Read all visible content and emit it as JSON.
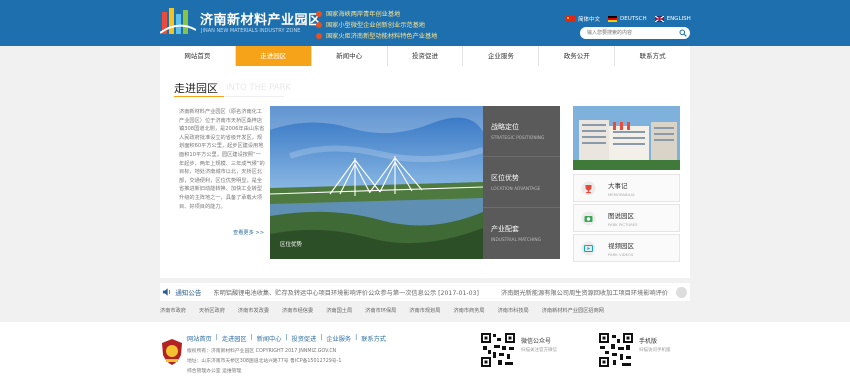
{
  "header": {
    "brand_cn": "济南新材料产业园区",
    "brand_en": "JINAN NEW MATERIALS INDUSTRY ZONE",
    "slogans": [
      "国家海峡两岸青年创业基地",
      "国家小型微型企业创新创业示范基地",
      "国家火炬济南新型功能材料特色产业基地"
    ],
    "langs": [
      "简体中文",
      "DEUTSCH",
      "ENGLISH"
    ],
    "search_placeholder": "输入您要搜索的内容"
  },
  "nav": [
    "网站首页",
    "走进园区",
    "新闻中心",
    "投资促进",
    "企业服务",
    "政务公开",
    "联系方式"
  ],
  "main": {
    "title": "走进园区",
    "title_en": "INTO THE PARK",
    "intro": "济南新材料产业园区（原名济南化工产业园区）位于济南市天桥区桑梓店镇308国道北侧，是2006年由山东省人民政府批准设立的省级开发区，规划面积60平方公里，起步区建设用地面积10平方公里。园区建设按照“一年起步、两年上规模、三年成气候”的目标，地处济南城市以北，天桥区北部，交通便利，区位优势明显，是全省推进新旧动能转换、加快工业转型升级的主阵地之一，具备了承载大项目、好项目的能力。",
    "more": "查看更多 >>",
    "photo_caption": "区位优势",
    "tabs": [
      {
        "cn": "战略定位",
        "en": "STRATEGIC POSITIONING"
      },
      {
        "cn": "区位优势",
        "en": "LOCATION ADVANTAGE"
      },
      {
        "cn": "产业配套",
        "en": "INDUSTRIAL MATCHING"
      }
    ],
    "cards": [
      {
        "cn": "大事记",
        "en": "MEMORABILIA"
      },
      {
        "cn": "图说园区",
        "en": "PARK PICTURES"
      },
      {
        "cn": "视频园区",
        "en": "PARK VIDEOS"
      }
    ]
  },
  "notice": {
    "label": "通知公告",
    "items": [
      "东明铝酸锂电池收集、贮存及转运中心项目环境影响评价公众参与第一次信息公示 [2017-01-03]",
      "济南朗光新能源有限公司周生资源回收加工项目环境影响评价"
    ]
  },
  "links": [
    "济南市政府",
    "天桥区政府",
    "济南市发改委",
    "济南市经信委",
    "济南国土局",
    "济南市环保局",
    "济南市规划局",
    "济南市商务局",
    "济南市科技局",
    "济南新材料产业园区招商网"
  ],
  "footer": {
    "nav": [
      "网站首页",
      "|",
      "走进园区",
      "|",
      "新闻中心",
      "|",
      "投资促进",
      "|",
      "企业服务",
      "|",
      "联系方式"
    ],
    "copyright": "版权所有：济南新材料产业园区 COPYRIGHT 2017 JNNMIZ.GOV.CN",
    "address": "地址：山东济南市天桥区308国道北站兴路77号 鲁ICP备15012729号-1",
    "admin": "综合管理办公室  运维管理",
    "qr1_title": "微信公众号",
    "qr1_sub": "扫描关注官方微信",
    "qr2_title": "手机版",
    "qr2_sub": "扫描访问手机版"
  },
  "colors": {
    "header": "#1e6fae",
    "accent": "#f7a31a",
    "tabs": "#5a5a5a",
    "link": "#2f6fa6"
  }
}
